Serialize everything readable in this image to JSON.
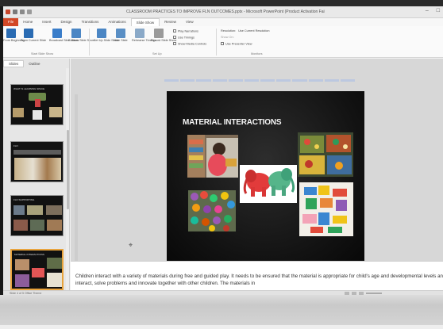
{
  "window": {
    "title": "CLASSROOM PRACTICES TO IMPROVE FLN OUTCOMES.pptx - Microsoft PowerPoint (Product Activation Failed)",
    "controls": {
      "minimize": "–",
      "maximize": "□"
    }
  },
  "tabs": [
    {
      "label": "File",
      "kind": "file"
    },
    {
      "label": "Home"
    },
    {
      "label": "Insert"
    },
    {
      "label": "Design"
    },
    {
      "label": "Transitions"
    },
    {
      "label": "Animations"
    },
    {
      "label": "Slide Show",
      "active": true
    },
    {
      "label": "Review"
    },
    {
      "label": "View"
    }
  ],
  "ribbon": {
    "buttons": [
      {
        "label": "From Beginning",
        "icon": "play-from-start-icon",
        "color": "#2b6cb3"
      },
      {
        "label": "From Current Slide",
        "icon": "play-current-icon",
        "color": "#2b6cb3"
      },
      {
        "label": "Broadcast Slide Show",
        "icon": "broadcast-icon",
        "color": "#3a7dc9"
      },
      {
        "label": "Custom Slide Show",
        "icon": "custom-show-icon",
        "color": "#4b86c4"
      },
      {
        "label": "Set Up Slide Show",
        "icon": "setup-show-icon",
        "color": "#4b86c4"
      },
      {
        "label": "Hide Slide",
        "icon": "hide-slide-icon",
        "color": "#5a8fc5"
      },
      {
        "label": "Rehearse Timings",
        "icon": "rehearse-icon",
        "color": "#8aa9c8"
      },
      {
        "label": "Record Slide Show",
        "icon": "record-icon",
        "color": "#9a9a9a"
      }
    ],
    "checkboxes": {
      "play_narrations": "Play Narrations",
      "use_timings": "Use Timings",
      "show_media_controls": "Show Media Controls"
    },
    "monitors": {
      "resolution_label": "Resolution:",
      "resolution_value": "Use Current Resolution",
      "show_on_label": "Show On:",
      "presenter_view": "Use Presenter View"
    },
    "groups": {
      "start": "Start Slide Show",
      "setup": "Set Up",
      "monitors": "Monitors"
    }
  },
  "sidebar": {
    "tabs": [
      "Slides",
      "Outline"
    ],
    "slides": [
      {
        "num": "",
        "title": "WHAT IS LEARNING SPACE",
        "selected": false
      },
      {
        "num": "",
        "title": "FLN",
        "selected": false
      },
      {
        "num": "",
        "title": "FLN SUPPORTING",
        "selected": false
      },
      {
        "num": "",
        "title": "MATERIAL INTERACTIONS",
        "selected": true
      }
    ]
  },
  "slide": {
    "title": "MATERIAL INTERACTIONS",
    "background": "#111111"
  },
  "notes": {
    "text": "Children interact with a variety of materials during free and guided play. It needs to be ensured that the material is appropriate for child's age and developmental levels and provides opportunities for children to play and interact, solve problems and innovate together with other children. The materials in"
  },
  "status": {
    "left": "Slide 4 of 5   Office Theme"
  }
}
